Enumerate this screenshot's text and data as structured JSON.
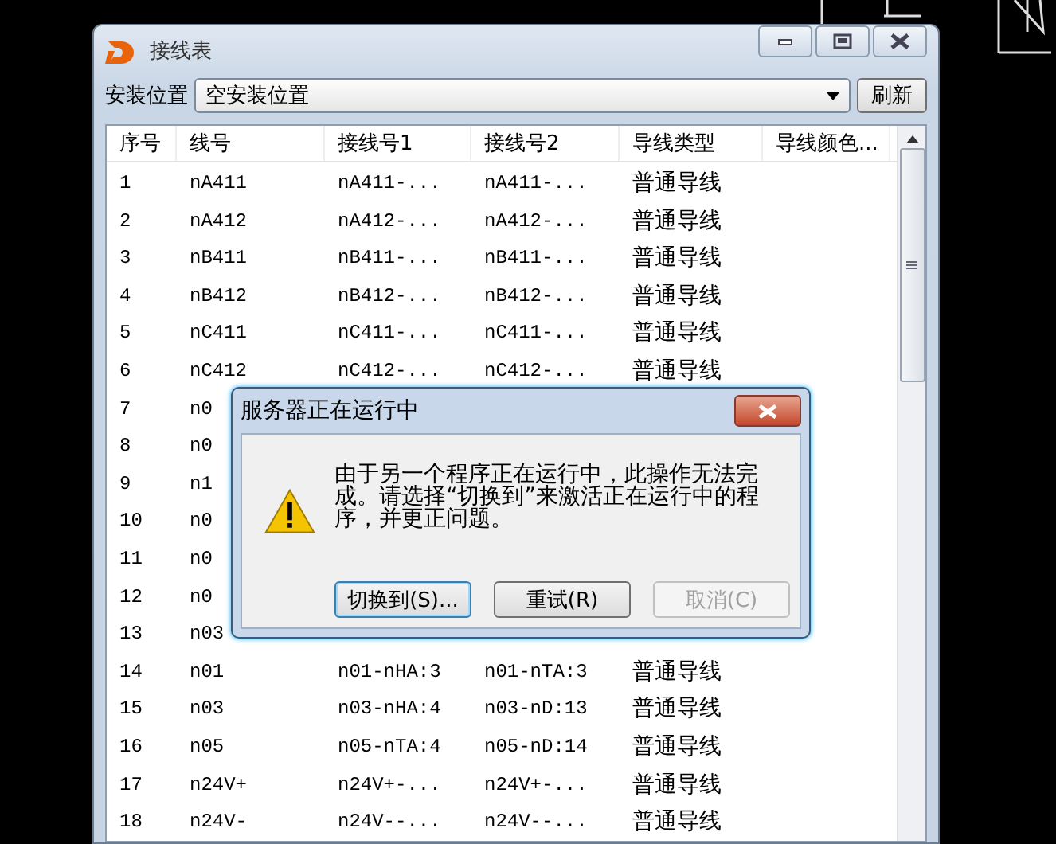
{
  "window": {
    "title": "接线表"
  },
  "toolbar": {
    "label": "安装位置",
    "dropdown_value": "空安装位置",
    "refresh_button": "刷新"
  },
  "table": {
    "columns": [
      "序号",
      "线号",
      "接线号1",
      "接线号2",
      "导线类型",
      "导线颜色..."
    ],
    "rows": [
      {
        "cells": [
          "1",
          "nA411",
          "nA411-...",
          "nA411-...",
          "普通导线"
        ]
      },
      {
        "cells": [
          "2",
          "nA412",
          "nA412-...",
          "nA412-...",
          "普通导线"
        ]
      },
      {
        "cells": [
          "3",
          "nB411",
          "nB411-...",
          "nB411-...",
          "普通导线"
        ]
      },
      {
        "cells": [
          "4",
          "nB412",
          "nB412-...",
          "nB412-...",
          "普通导线"
        ]
      },
      {
        "cells": [
          "5",
          "nC411",
          "nC411-...",
          "nC411-...",
          "普通导线"
        ]
      },
      {
        "cells": [
          "6",
          "nC412",
          "nC412-...",
          "nC412-...",
          "普通导线"
        ]
      },
      {
        "cells": [
          "7",
          "n0"
        ]
      },
      {
        "cells": [
          "8",
          "n0"
        ]
      },
      {
        "cells": [
          "9",
          "n1"
        ]
      },
      {
        "cells": [
          "10",
          "n0"
        ]
      },
      {
        "cells": [
          "11",
          "n0"
        ]
      },
      {
        "cells": [
          "12",
          "n0"
        ]
      },
      {
        "cells": [
          "13",
          "n03"
        ]
      },
      {
        "cells": [
          "14",
          "n01",
          "n01-nHA:3",
          "n01-nTA:3",
          "普通导线"
        ]
      },
      {
        "cells": [
          "15",
          "n03",
          "n03-nHA:4",
          "n03-nD:13",
          "普通导线"
        ]
      },
      {
        "cells": [
          "16",
          "n05",
          "n05-nTA:4",
          "n05-nD:14",
          "普通导线"
        ]
      },
      {
        "cells": [
          "17",
          "n24V+",
          "n24V+-...",
          "n24V+-...",
          "普通导线"
        ]
      },
      {
        "cells": [
          "18",
          "n24V-",
          "n24V--...",
          "n24V--...",
          "普通导线"
        ]
      }
    ]
  },
  "dialog": {
    "title": "服务器正在运行中",
    "message": "由于另一个程序正在运行中，此操作无法完成。请选择“切换到”来激活正在运行中的程序，并更正问题。",
    "buttons": [
      {
        "label": "切换到(S)...",
        "focused": true,
        "disabled": false
      },
      {
        "label": "重试(R)",
        "focused": false,
        "disabled": false
      },
      {
        "label": "取消(C)",
        "focused": false,
        "disabled": true
      }
    ]
  }
}
